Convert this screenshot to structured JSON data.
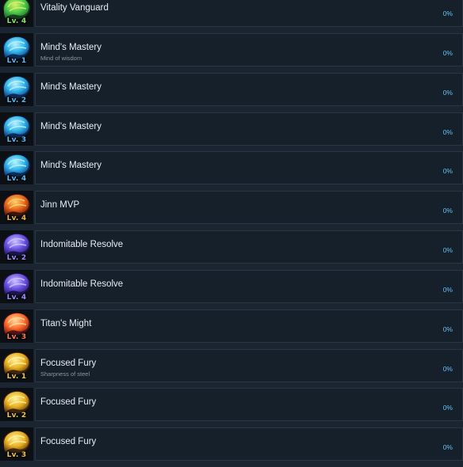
{
  "achievements": [
    {
      "title": "Vitality Vanguard",
      "subtitle": "",
      "level": "Lv. 4",
      "percent": "0%",
      "icon": "vitality-emblem-icon",
      "theme": "green"
    },
    {
      "title": "Mind's Mastery",
      "subtitle": "Mind of wisdom",
      "level": "Lv. 1",
      "percent": "0%",
      "icon": "mind-emblem-icon",
      "theme": "cyan"
    },
    {
      "title": "Mind's Mastery",
      "subtitle": "",
      "level": "Lv. 2",
      "percent": "0%",
      "icon": "mind-emblem-icon",
      "theme": "cyan"
    },
    {
      "title": "Mind's Mastery",
      "subtitle": "",
      "level": "Lv. 3",
      "percent": "0%",
      "icon": "mind-emblem-icon",
      "theme": "cyan"
    },
    {
      "title": "Mind's Mastery",
      "subtitle": "",
      "level": "Lv. 4",
      "percent": "0%",
      "icon": "mind-emblem-icon",
      "theme": "cyan"
    },
    {
      "title": "Jinn MVP",
      "subtitle": "",
      "level": "Lv. 4",
      "percent": "0%",
      "icon": "jinn-emblem-icon",
      "theme": "orange"
    },
    {
      "title": "Indomitable Resolve",
      "subtitle": "",
      "level": "Lv. 2",
      "percent": "0%",
      "icon": "resolve-emblem-icon",
      "theme": "purple"
    },
    {
      "title": "Indomitable Resolve",
      "subtitle": "",
      "level": "Lv. 4",
      "percent": "0%",
      "icon": "resolve-emblem-icon",
      "theme": "purple"
    },
    {
      "title": "Titan's Might",
      "subtitle": "",
      "level": "Lv. 3",
      "percent": "0%",
      "icon": "titan-emblem-icon",
      "theme": "red"
    },
    {
      "title": "Focused Fury",
      "subtitle": "Sharpness of steel",
      "level": "Lv. 1",
      "percent": "0%",
      "icon": "fury-emblem-icon",
      "theme": "gold"
    },
    {
      "title": "Focused Fury",
      "subtitle": "",
      "level": "Lv. 2",
      "percent": "0%",
      "icon": "fury-emblem-icon",
      "theme": "gold"
    },
    {
      "title": "Focused Fury",
      "subtitle": "",
      "level": "Lv. 3",
      "percent": "0%",
      "icon": "fury-emblem-icon",
      "theme": "gold"
    }
  ],
  "themes": {
    "green": {
      "a": "#d9f26a",
      "b": "#4cc94a",
      "c": "#1d6b2c",
      "level": "#8fe26b"
    },
    "cyan": {
      "a": "#b8f4ff",
      "b": "#2fb0e8",
      "c": "#0f3f8a",
      "level": "#5ab8f2"
    },
    "orange": {
      "a": "#ffd36a",
      "b": "#e8641c",
      "c": "#6a1a0a",
      "level": "#f0b24a"
    },
    "purple": {
      "a": "#cfc4ff",
      "b": "#6a52e0",
      "c": "#2a1a7a",
      "level": "#9c8cff"
    },
    "red": {
      "a": "#ffe0a0",
      "b": "#ff6a2a",
      "c": "#8a1a14",
      "level": "#ff7a5a"
    },
    "gold": {
      "a": "#fff2a0",
      "b": "#e8b020",
      "c": "#6a3a08",
      "level": "#f0c24a"
    }
  }
}
